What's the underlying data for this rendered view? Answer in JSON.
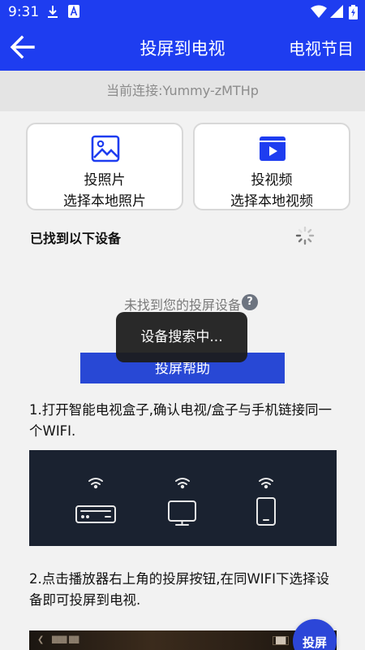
{
  "status_bar": {
    "time": "9:31",
    "icons": [
      "download-icon",
      "a-badge-icon",
      "wifi-icon",
      "signal-icon",
      "battery-icon"
    ]
  },
  "app_bar": {
    "title": "投屏到电视",
    "right_action": "电视节目",
    "back_icon": "arrow-left-icon"
  },
  "connection": {
    "text": "当前连接:Yummy-zMTHp"
  },
  "cards": [
    {
      "title": "投照片",
      "subtitle": "选择本地照片",
      "icon": "image-icon"
    },
    {
      "title": "投视频",
      "subtitle": "选择本地视频",
      "icon": "video-icon"
    }
  ],
  "devices": {
    "header": "已找到以下设备",
    "empty_text": "未找到您的投屏设备",
    "help_icon": "question-icon"
  },
  "help_button": {
    "label": "投屏帮助"
  },
  "toast": {
    "text": "设备搜索中..."
  },
  "steps": [
    {
      "text": "1.打开智能电视盒子,确认电视/盒子与手机链接同一个WIFI."
    },
    {
      "text": "2.点击播放器右上角的投屏按钮,在同WIFI下选择设备即可投屏到电视."
    }
  ],
  "fab": {
    "label": "投屏"
  },
  "colors": {
    "accent": "#1e3df0",
    "button": "#2848d5",
    "background": "#f2f2f2"
  }
}
